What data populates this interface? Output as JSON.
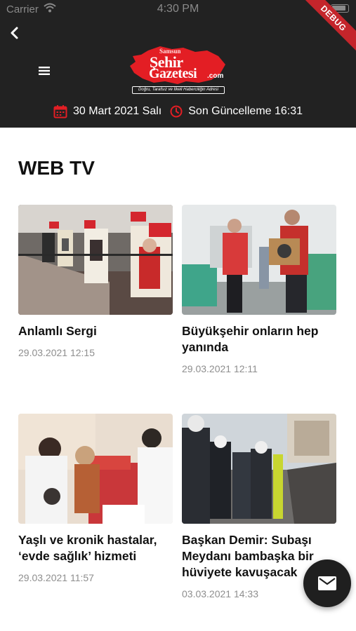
{
  "status_bar": {
    "carrier": "Carrier",
    "time": "4:30 PM"
  },
  "debug_banner": "DEBUG",
  "logo": {
    "top_word": "Samsun",
    "line1": "Şehir",
    "line2": "Gazetesi",
    "dotcom": ".com",
    "tagline": "Doğru, Tarafsız ve İlkeli Haberciliğin Adresi",
    "color": "#e31e24"
  },
  "header_info": {
    "date": "30 Mart 2021 Salı",
    "last_update": "Son Güncelleme 16:31",
    "icon_color": "#e31e24"
  },
  "section_title": "WEB TV",
  "videos": [
    {
      "title": "Anlamlı Sergi",
      "date": "29.03.2021 12:15"
    },
    {
      "title": "Büyükşehir onların hep yanında",
      "date": "29.03.2021 12:11"
    },
    {
      "title": "Yaşlı ve kronik hastalar, ‘evde sağlık’ hizmeti",
      "date": "29.03.2021 11:57"
    },
    {
      "title": "Başkan Demir: Subaşı Meydanı bambaşka bir hüviyete kavuşacak",
      "date": "03.03.2021 14:33"
    }
  ],
  "icons": {
    "back": "chevron-left-icon",
    "menu": "hamburger-icon",
    "calendar": "calendar-icon",
    "clock": "clock-icon",
    "fab": "mail-icon"
  }
}
